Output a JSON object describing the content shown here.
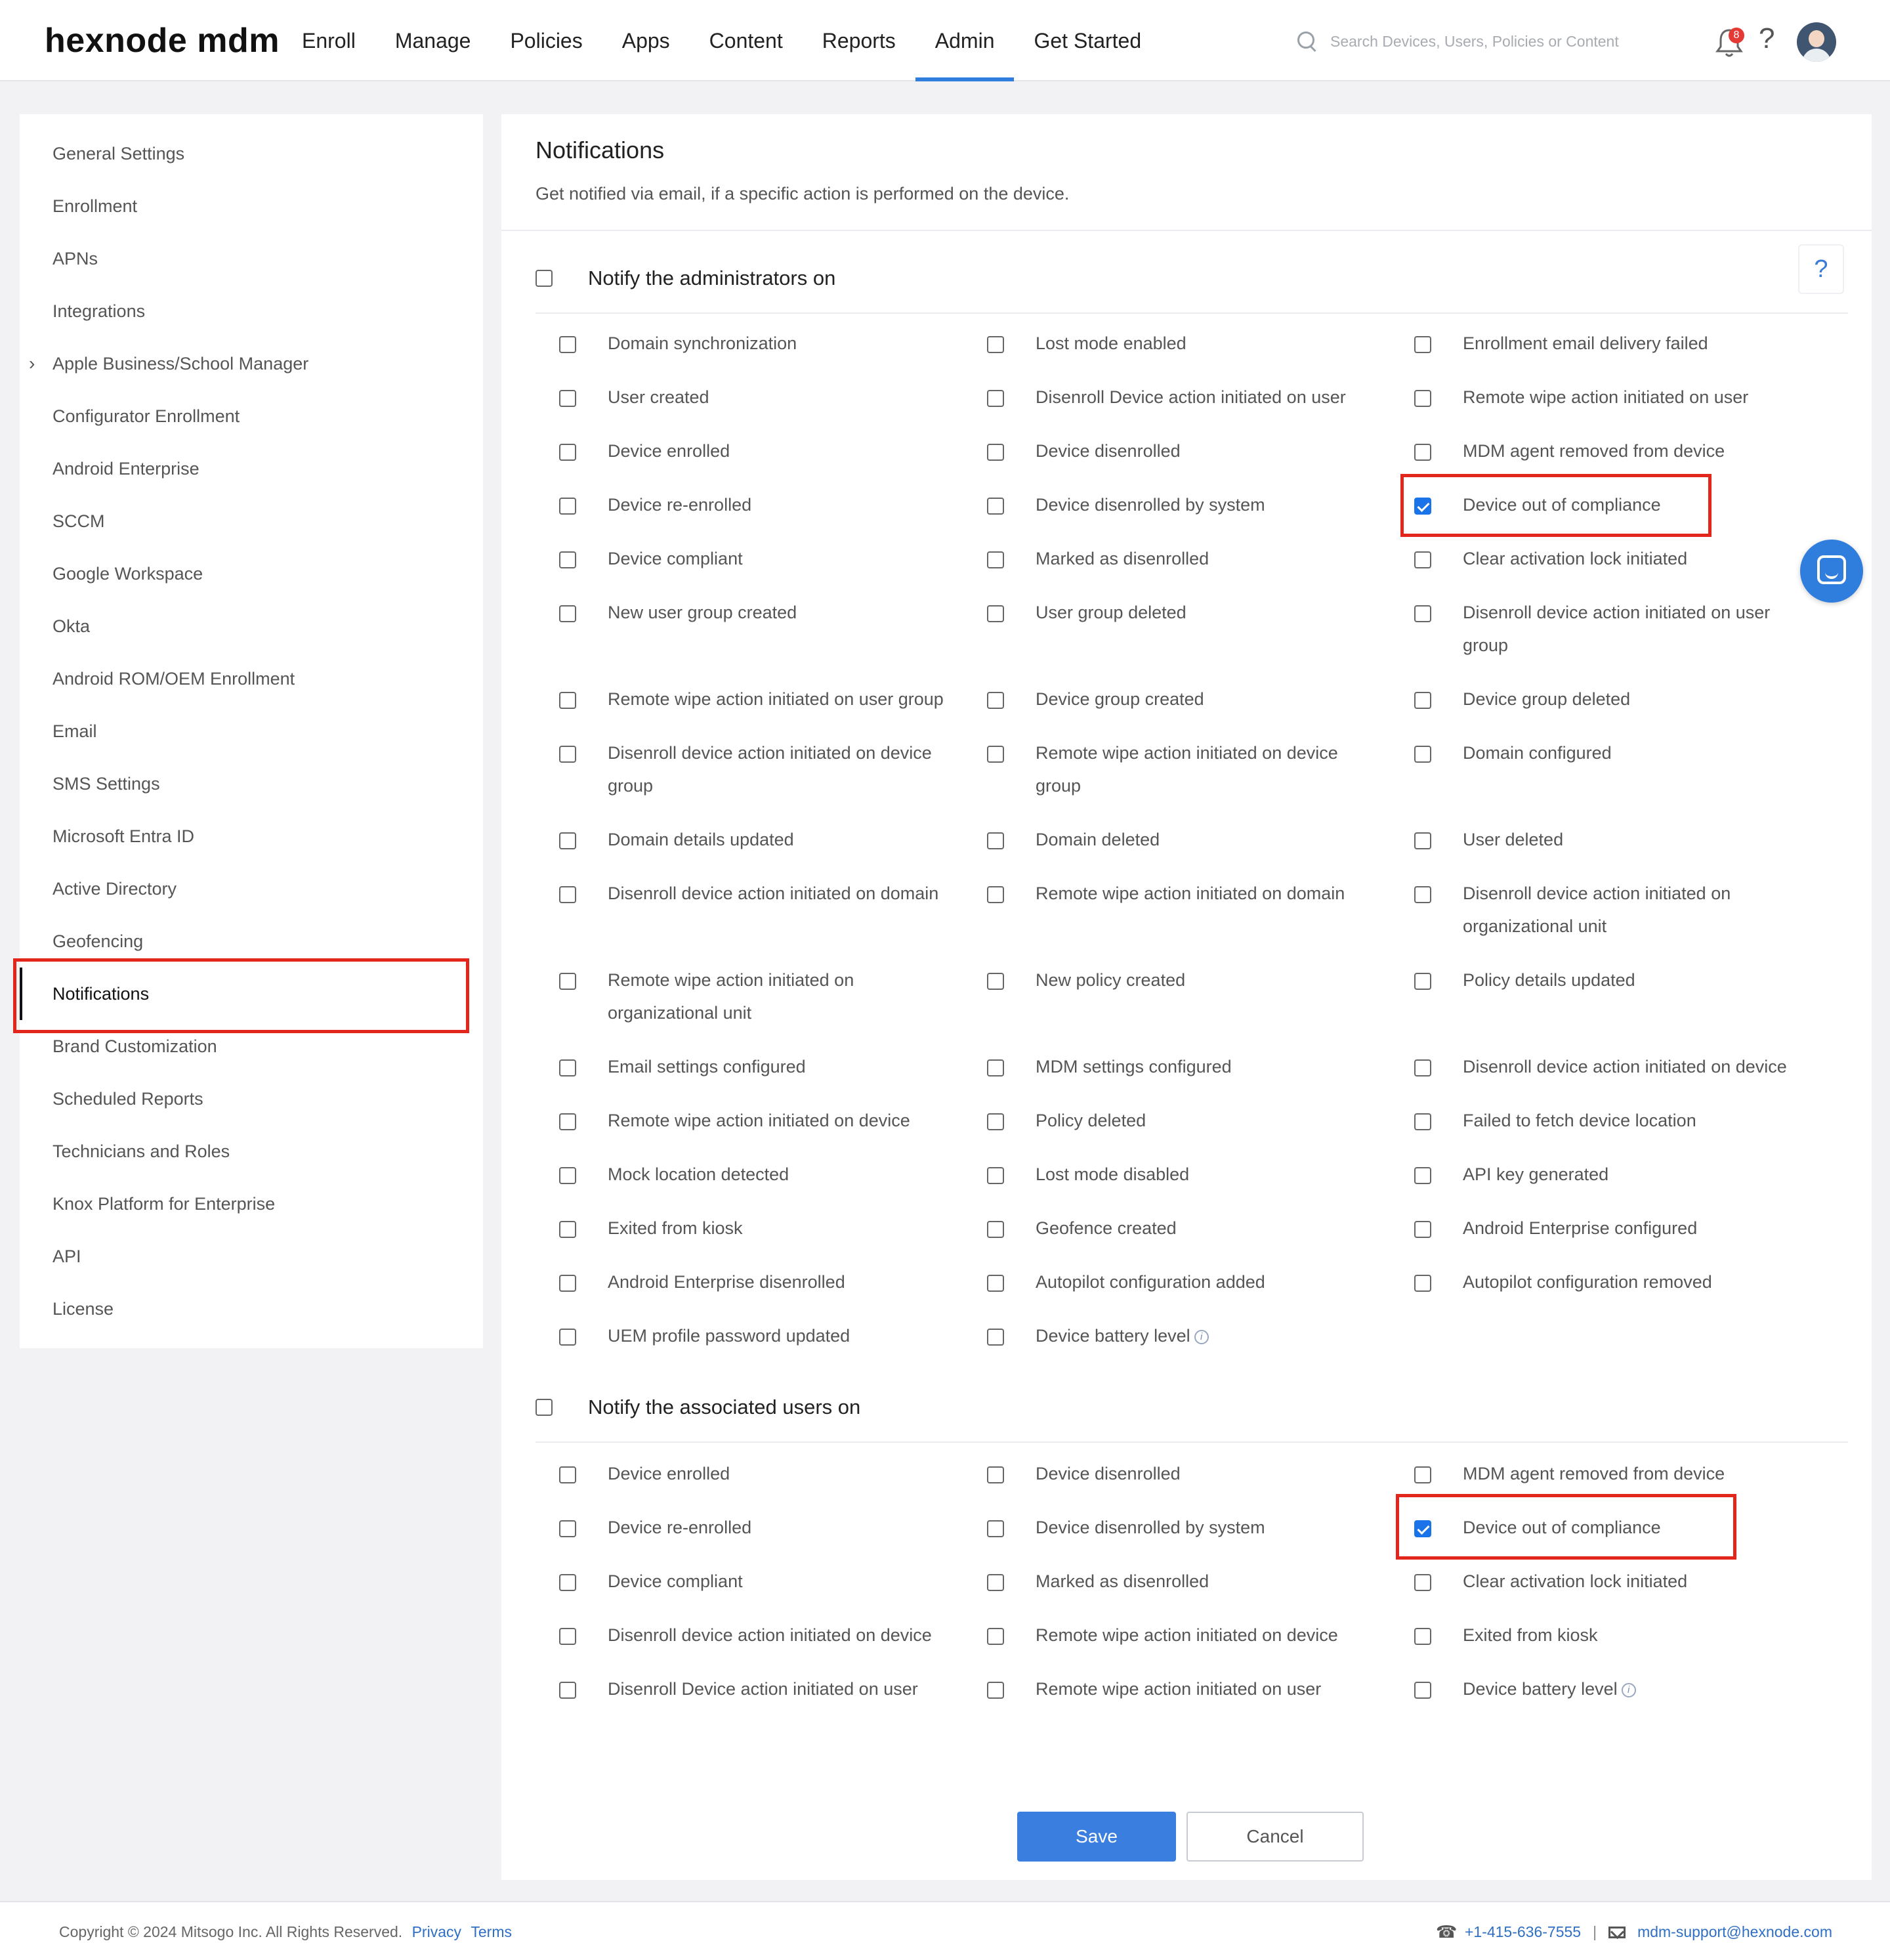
{
  "header": {
    "logo": "hexnode mdm",
    "nav": [
      "Enroll",
      "Manage",
      "Policies",
      "Apps",
      "Content",
      "Reports",
      "Admin",
      "Get Started"
    ],
    "active_nav": "Admin",
    "search_placeholder": "Search Devices, Users, Policies or Content",
    "notification_count": "8",
    "help": "?"
  },
  "sidebar": {
    "items": [
      "General Settings",
      "Enrollment",
      "APNs",
      "Integrations",
      "Apple Business/School Manager",
      "Configurator Enrollment",
      "Android Enterprise",
      "SCCM",
      "Google Workspace",
      "Okta",
      "Android ROM/OEM Enrollment",
      "Email",
      "SMS Settings",
      "Microsoft Entra ID",
      "Active Directory",
      "Geofencing",
      "Notifications",
      "Brand Customization",
      "Scheduled Reports",
      "Technicians and Roles",
      "Knox Platform for Enterprise",
      "API",
      "License"
    ],
    "active": "Notifications"
  },
  "main": {
    "title": "Notifications",
    "subtitle": "Get notified via email, if a specific action is performed on the device.",
    "help": "?",
    "admin_section": {
      "label": "Notify the administrators on",
      "rows": [
        [
          {
            "label": "Domain synchronization",
            "checked": false
          },
          {
            "label": "Lost mode enabled",
            "checked": false
          },
          {
            "label": "Enrollment email delivery failed",
            "checked": false
          }
        ],
        [
          {
            "label": "User created",
            "checked": false
          },
          {
            "label": "Disenroll Device action initiated on user",
            "checked": false
          },
          {
            "label": "Remote wipe action initiated on user",
            "checked": false
          }
        ],
        [
          {
            "label": "Device enrolled",
            "checked": false
          },
          {
            "label": "Device disenrolled",
            "checked": false
          },
          {
            "label": "MDM agent removed from device",
            "checked": false
          }
        ],
        [
          {
            "label": "Device re-enrolled",
            "checked": false
          },
          {
            "label": "Device disenrolled by system",
            "checked": false
          },
          {
            "label": "Device out of compliance",
            "checked": true
          }
        ],
        [
          {
            "label": "Device compliant",
            "checked": false
          },
          {
            "label": "Marked as disenrolled",
            "checked": false
          },
          {
            "label": "Clear activation lock initiated",
            "checked": false
          }
        ],
        [
          {
            "label": "New user group created",
            "checked": false
          },
          {
            "label": "User group deleted",
            "checked": false
          },
          {
            "label": "Disenroll device action initiated on user group",
            "checked": false
          }
        ],
        [
          {
            "label": "Remote wipe action initiated on user group",
            "checked": false
          },
          {
            "label": "Device group created",
            "checked": false
          },
          {
            "label": "Device group deleted",
            "checked": false
          }
        ],
        [
          {
            "label": "Disenroll device action initiated on device group",
            "checked": false
          },
          {
            "label": "Remote wipe action initiated on device group",
            "checked": false
          },
          {
            "label": "Domain configured",
            "checked": false
          }
        ],
        [
          {
            "label": "Domain details updated",
            "checked": false
          },
          {
            "label": "Domain deleted",
            "checked": false
          },
          {
            "label": "User deleted",
            "checked": false
          }
        ],
        [
          {
            "label": "Disenroll device action initiated on domain",
            "checked": false
          },
          {
            "label": "Remote wipe action initiated on domain",
            "checked": false
          },
          {
            "label": "Disenroll device action initiated on organizational unit",
            "checked": false
          }
        ],
        [
          {
            "label": "Remote wipe action initiated on organizational unit",
            "checked": false
          },
          {
            "label": "New policy created",
            "checked": false
          },
          {
            "label": "Policy details updated",
            "checked": false
          }
        ],
        [
          {
            "label": "Email settings configured",
            "checked": false
          },
          {
            "label": "MDM settings configured",
            "checked": false
          },
          {
            "label": "Disenroll device action initiated on device",
            "checked": false
          }
        ],
        [
          {
            "label": "Remote wipe action initiated on device",
            "checked": false
          },
          {
            "label": "Policy deleted",
            "checked": false
          },
          {
            "label": "Failed to fetch device location",
            "checked": false
          }
        ],
        [
          {
            "label": "Mock location detected",
            "checked": false
          },
          {
            "label": "Lost mode disabled",
            "checked": false
          },
          {
            "label": "API key generated",
            "checked": false
          }
        ],
        [
          {
            "label": "Exited from kiosk",
            "checked": false
          },
          {
            "label": "Geofence created",
            "checked": false
          },
          {
            "label": "Android Enterprise configured",
            "checked": false
          }
        ],
        [
          {
            "label": "Android Enterprise disenrolled",
            "checked": false
          },
          {
            "label": "Autopilot configuration added",
            "checked": false
          },
          {
            "label": "Autopilot configuration removed",
            "checked": false
          }
        ],
        [
          {
            "label": "UEM profile password updated",
            "checked": false
          },
          {
            "label": "Device battery level",
            "checked": false,
            "info": "i"
          }
        ]
      ]
    },
    "user_section": {
      "label": "Notify the associated users on",
      "rows": [
        [
          {
            "label": "Device enrolled",
            "checked": false
          },
          {
            "label": "Device disenrolled",
            "checked": false
          },
          {
            "label": "MDM agent removed from device",
            "checked": false
          }
        ],
        [
          {
            "label": "Device re-enrolled",
            "checked": false
          },
          {
            "label": "Device disenrolled by system",
            "checked": false
          },
          {
            "label": "Device out of compliance",
            "checked": true
          }
        ],
        [
          {
            "label": "Device compliant",
            "checked": false
          },
          {
            "label": "Marked as disenrolled",
            "checked": false
          },
          {
            "label": "Clear activation lock initiated",
            "checked": false
          }
        ],
        [
          {
            "label": "Disenroll device action initiated on device",
            "checked": false
          },
          {
            "label": "Remote wipe action initiated on device",
            "checked": false
          },
          {
            "label": "Exited from kiosk",
            "checked": false
          }
        ],
        [
          {
            "label": "Disenroll Device action initiated on user",
            "checked": false
          },
          {
            "label": "Remote wipe action initiated on user",
            "checked": false
          },
          {
            "label": "Device battery level",
            "checked": false,
            "info": "i"
          }
        ]
      ]
    },
    "save_label": "Save",
    "cancel_label": "Cancel"
  },
  "footer": {
    "copyright": "Copyright © 2024 Mitsogo Inc. All Rights Reserved.",
    "privacy": "Privacy",
    "terms": "Terms",
    "phone": "+1-415-636-7555",
    "separator": "|",
    "email": "mdm-support@hexnode.com"
  }
}
